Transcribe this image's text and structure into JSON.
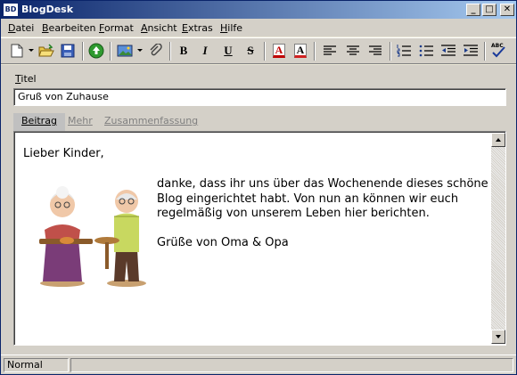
{
  "window": {
    "title": "BlogDesk",
    "icon_text": "BD"
  },
  "title_controls": {
    "minimize": "_",
    "maximize": "□",
    "close": "✕"
  },
  "menu": [
    {
      "label": "Datei",
      "accel": "D",
      "rest": "atei"
    },
    {
      "label": "Bearbeiten",
      "accel": "B",
      "rest": "earbeiten"
    },
    {
      "label": "Format",
      "accel": "F",
      "rest": "ormat"
    },
    {
      "label": "Ansicht",
      "accel": "A",
      "rest": "nsicht"
    },
    {
      "label": "Extras",
      "accel": "E",
      "rest": "xtras"
    },
    {
      "label": "Hilfe",
      "accel": "H",
      "rest": "ilfe"
    }
  ],
  "toolbar": {
    "bold": "B",
    "italic": "I",
    "underline": "U",
    "strike": "S",
    "font_color": "A",
    "highlight": "A",
    "spell": "ABC"
  },
  "title_field": {
    "label": "Titel",
    "label_accel": "T",
    "label_rest": "itel",
    "value": "Gruß von Zuhause"
  },
  "tabs": [
    {
      "label": "Beitrag",
      "active": true
    },
    {
      "label": "Mehr",
      "active": false
    },
    {
      "label": "Zusammenfassung",
      "active": false
    }
  ],
  "post": {
    "salutation": "Lieber Kinder,",
    "body": "danke, dass ihr uns über das Wochenende dieses schöne Blog eingerichtet habt. Von nun an können wir euch regelmäßig von unserem Leben hier berichten.",
    "signature": "Grüße von Oma & Opa"
  },
  "status": {
    "paragraph_style": "Normal"
  },
  "colors": {
    "titlebar_start": "#0a246a",
    "titlebar_end": "#a6caf0",
    "face": "#d4d0c8"
  }
}
